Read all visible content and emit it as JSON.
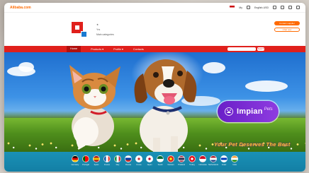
{
  "topbar": {
    "logo_text": "Alibaba.com",
    "region_label": "My",
    "language_label": "English-USD",
    "accent_color": "#ff6a00"
  },
  "store": {
    "label_top": "★",
    "label_mid": "Yrs",
    "label_bottom": "Main categories",
    "btn_primary": "Contact supplier",
    "btn_secondary": "Chat now"
  },
  "nav": {
    "color": "#e0201c",
    "items": [
      {
        "label": "Home",
        "active": true
      },
      {
        "label": "Products ▾",
        "active": false
      },
      {
        "label": "Profile ▾",
        "active": false
      },
      {
        "label": "Contacts",
        "active": false
      }
    ],
    "search_button": "Search"
  },
  "hero": {
    "brand_name": "Impian",
    "brand_suffix": "Pets",
    "tagline": "Your Pet Deserves The Best",
    "tagline_color": "#ffd11a",
    "badge_color": "#7a2bd4"
  },
  "flags": [
    {
      "label": "Germany",
      "colors": [
        "#000000",
        "#dd0000",
        "#ffce00"
      ],
      "style": "h3"
    },
    {
      "label": "Portugal",
      "colors": [
        "#006600",
        "#ff0000"
      ],
      "style": "v2"
    },
    {
      "label": "Spain",
      "colors": [
        "#aa151b",
        "#f1bf00",
        "#aa151b"
      ],
      "style": "h3"
    },
    {
      "label": "France",
      "colors": [
        "#0055a4",
        "#ffffff",
        "#ef4135"
      ],
      "style": "v3"
    },
    {
      "label": "Italy",
      "colors": [
        "#009246",
        "#ffffff",
        "#ce2b37"
      ],
      "style": "v3"
    },
    {
      "label": "Russia",
      "colors": [
        "#ffffff",
        "#0039a6",
        "#d52b1e"
      ],
      "style": "h3"
    },
    {
      "label": "Korea",
      "colors": [
        "#ffffff",
        "#cd2e3a"
      ],
      "style": "dot"
    },
    {
      "label": "Japan",
      "colors": [
        "#ffffff",
        "#bc002d"
      ],
      "style": "dot"
    },
    {
      "label": "Saudi",
      "colors": [
        "#006c35",
        "#ffffff"
      ],
      "style": "h2"
    },
    {
      "label": "Vietnam",
      "colors": [
        "#da251d",
        "#ffff00"
      ],
      "style": "dot"
    },
    {
      "label": "Thailand",
      "colors": [
        "#a51931",
        "#f4f5f8",
        "#2d2a4a",
        "#f4f5f8",
        "#a51931"
      ],
      "style": "h5"
    },
    {
      "label": "Turkey",
      "colors": [
        "#e30a17",
        "#ffffff"
      ],
      "style": "dot"
    },
    {
      "label": "Indonesia",
      "colors": [
        "#ce1126",
        "#ffffff"
      ],
      "style": "h2"
    },
    {
      "label": "Netherlands",
      "colors": [
        "#ae1c28",
        "#ffffff",
        "#21468b"
      ],
      "style": "h3"
    },
    {
      "label": "Israel",
      "colors": [
        "#ffffff",
        "#0038b8",
        "#ffffff"
      ],
      "style": "h3"
    },
    {
      "label": "India",
      "colors": [
        "#ff9933",
        "#ffffff",
        "#138808"
      ],
      "style": "h3"
    }
  ]
}
